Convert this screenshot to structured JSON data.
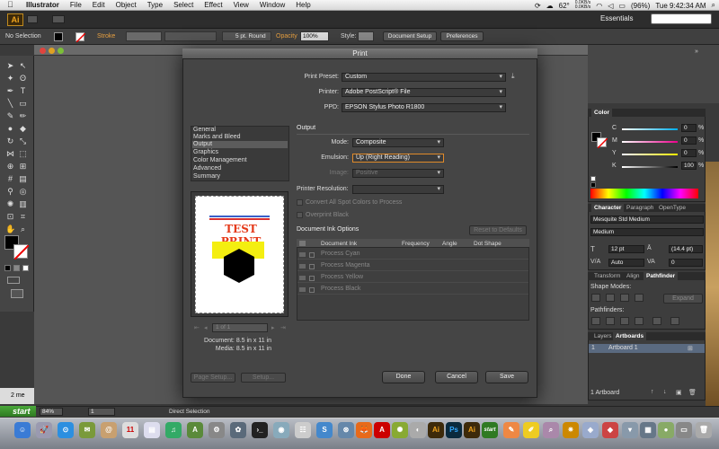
{
  "menubar": {
    "app_name": "Illustrator",
    "items": [
      "File",
      "Edit",
      "Object",
      "Type",
      "Select",
      "Effect",
      "View",
      "Window",
      "Help"
    ],
    "temperature": "62°",
    "net_up": "0.0KB/s",
    "net_down": "0.0KB/s",
    "battery": "(96%)",
    "clock": "Tue 9:42:34 AM"
  },
  "appbar": {
    "logo": "Ai",
    "workspace": "Essentials"
  },
  "control_bar": {
    "selection": "No Selection",
    "stroke_label": "Stroke",
    "brush": "5 pt. Round",
    "opacity_label": "Opacity",
    "opacity_value": "100%",
    "style_label": "Style:",
    "document_setup": "Document Setup",
    "preferences": "Preferences"
  },
  "print_dialog": {
    "title": "Print",
    "print_preset_label": "Print Preset:",
    "print_preset": "Custom",
    "printer_label": "Printer:",
    "printer": "Adobe PostScript® File",
    "ppd_label": "PPD:",
    "ppd": "EPSON Stylus Photo R1800",
    "categories": [
      "General",
      "Marks and Bleed",
      "Output",
      "Graphics",
      "Color Management",
      "Advanced",
      "Summary"
    ],
    "selected_category": "Output",
    "section_title": "Output",
    "mode_label": "Mode:",
    "mode": "Composite",
    "emulsion_label": "Emulsion:",
    "emulsion": "Up (Right Reading)",
    "image_label": "Image:",
    "image": "Positive",
    "printer_resolution_label": "Printer Resolution:",
    "convert_spot": "Convert All Spot Colors to Process",
    "overprint_black": "Overprint Black",
    "doc_ink_options": "Document Ink Options",
    "reset_defaults": "Reset to Defaults",
    "ink_headers": [
      "Document Ink",
      "Frequency",
      "Angle",
      "Dot Shape"
    ],
    "inks": [
      "Process Cyan",
      "Process Magenta",
      "Process Yellow",
      "Process Black"
    ],
    "preview_text": "TEST PRINT",
    "page_nav": "1 of 1",
    "document_size": "Document: 8.5 in x 11 in",
    "media_size": "Media: 8.5 in x 11 in",
    "page_setup": "Page Setup...",
    "setup": "Setup...",
    "done": "Done",
    "cancel": "Cancel",
    "save": "Save"
  },
  "color_panel": {
    "title": "Color",
    "channels": [
      {
        "label": "C",
        "value": "0"
      },
      {
        "label": "M",
        "value": "0"
      },
      {
        "label": "Y",
        "value": "0"
      },
      {
        "label": "K",
        "value": "100"
      }
    ],
    "percent": "%"
  },
  "character_panel": {
    "tabs": [
      "Character",
      "Paragraph",
      "OpenType"
    ],
    "font": "Mesquite Std Medium",
    "style": "Medium",
    "size": "12 pt",
    "leading": "(14.4 pt)",
    "tracking": "Auto",
    "kerning": "0"
  },
  "pathfinder_panel": {
    "tabs": [
      "Transform",
      "Align",
      "Pathfinder"
    ],
    "shape_modes": "Shape Modes:",
    "expand": "Expand",
    "pathfinders": "Pathfinders:"
  },
  "artboards_panel": {
    "tabs": [
      "Layers",
      "Artboards"
    ],
    "rows": [
      {
        "index": "1",
        "name": "Artboard 1"
      }
    ],
    "count": "1 Artboard"
  },
  "status_bar": {
    "zoom": "84%",
    "artboard": "1",
    "tool": "Direct Selection",
    "start": "start",
    "window_tab": "2 me"
  },
  "dock": {
    "icons": [
      "Ai",
      "Ps",
      "Ai",
      "start"
    ]
  }
}
